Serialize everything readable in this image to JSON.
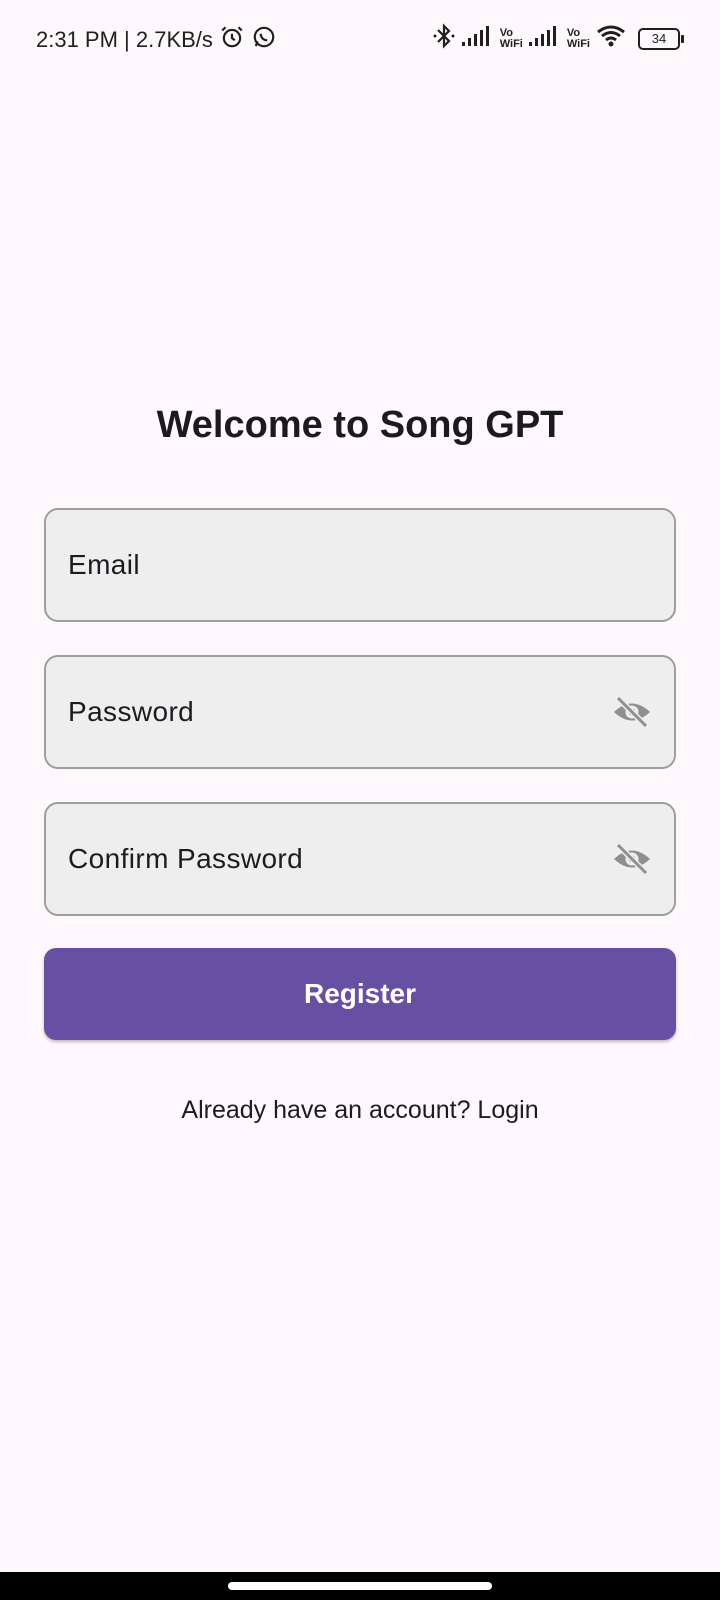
{
  "status_bar": {
    "time_speed": "2:31 PM | 2.7KB/s",
    "vo_label": "Vo",
    "wifi_label": "WiFi",
    "battery": "34"
  },
  "screen": {
    "title": "Welcome to Song GPT",
    "email_placeholder": "Email",
    "password_placeholder": "Password",
    "confirm_password_placeholder": "Confirm Password",
    "register_label": "Register",
    "login_prompt": "Already have an account? Login"
  },
  "colors": {
    "background": "#FEF7FB",
    "primary": "#6750A4",
    "field_fill": "#EEEEEE",
    "field_border": "#9E9E9E"
  }
}
